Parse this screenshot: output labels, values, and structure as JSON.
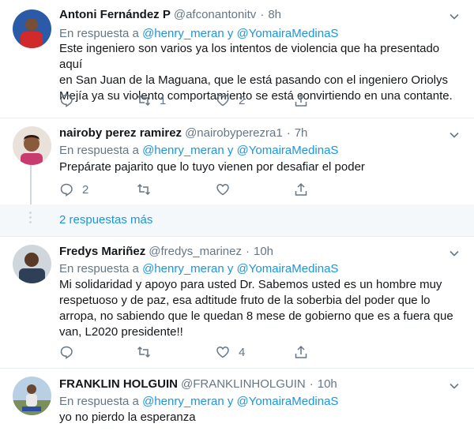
{
  "tweets": [
    {
      "name": "Antoni Fernández P",
      "handle": "@afconantonitv",
      "dot": "·",
      "time": "8h",
      "reply_prefix": "En respuesta a",
      "reply_user1": "@henry_meran",
      "reply_and": "y",
      "reply_user2": "@YomairaMedinaS",
      "lines": [
        "Este ingeniero son varios ya los intentos de violencia que ha presentado aquí",
        "en San Juan de la Maguana, que le está pasando con el ingeniero Oriolys",
        "Mejía ya su violento comportamiento se está convirtiendo en una contante."
      ],
      "retweets": "1",
      "likes": "2"
    },
    {
      "name": "nairoby perez ramirez",
      "handle": "@nairobyperezra1",
      "dot": "·",
      "time": "7h",
      "reply_prefix": "En respuesta a",
      "reply_user1": "@henry_meran",
      "reply_and": "y",
      "reply_user2": "@YomairaMedinaS",
      "lines": [
        "Prepárate pajarito que lo tuyo vienen por desafiar el poder"
      ],
      "replies": "2"
    },
    {
      "name": "Fredys Mariñez",
      "handle": "@fredys_marinez",
      "dot": "·",
      "time": "10h",
      "reply_prefix": "En respuesta a",
      "reply_user1": "@henry_meran",
      "reply_and": "y",
      "reply_user2": "@YomairaMedinaS",
      "lines": [
        "Mi solidaridad y apoyo para usted Dr. Sabemos usted es un hombre muy",
        "respetuoso y de paz, esa adtitude fruto de la soberbia del poder que lo",
        "arropa, no sabiendo que le quedan 8 mese de gobierno que es a fuera que",
        "van, L2020 presidente!!"
      ],
      "likes": "4"
    },
    {
      "name": "FRANKLIN HOLGUIN",
      "handle": "@FRANKLINHOLGUIN",
      "dot": "·",
      "time": "10h",
      "reply_prefix": "En respuesta a",
      "reply_user1": "@henry_meran",
      "reply_and": "y",
      "reply_user2": "@YomairaMedinaS",
      "lines": [
        "yo no pierdo la esperanza"
      ]
    }
  ],
  "more_replies": "2 respuestas más",
  "colors": {
    "link": "#1b95e0",
    "muted": "#657786",
    "border": "#e6ecf0"
  }
}
